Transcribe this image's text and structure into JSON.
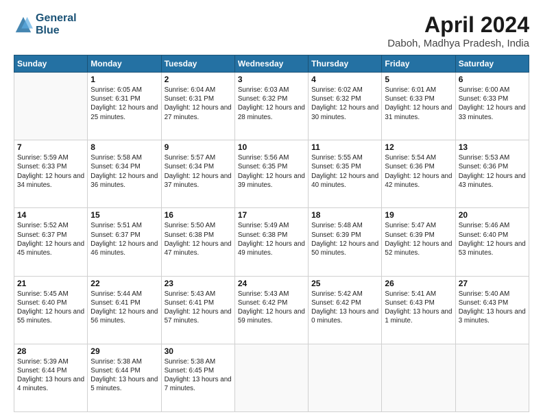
{
  "header": {
    "logo_line1": "General",
    "logo_line2": "Blue",
    "title": "April 2024",
    "subtitle": "Daboh, Madhya Pradesh, India"
  },
  "days_of_week": [
    "Sunday",
    "Monday",
    "Tuesday",
    "Wednesday",
    "Thursday",
    "Friday",
    "Saturday"
  ],
  "weeks": [
    [
      {
        "num": "",
        "info": ""
      },
      {
        "num": "1",
        "info": "Sunrise: 6:05 AM\nSunset: 6:31 PM\nDaylight: 12 hours\nand 25 minutes."
      },
      {
        "num": "2",
        "info": "Sunrise: 6:04 AM\nSunset: 6:31 PM\nDaylight: 12 hours\nand 27 minutes."
      },
      {
        "num": "3",
        "info": "Sunrise: 6:03 AM\nSunset: 6:32 PM\nDaylight: 12 hours\nand 28 minutes."
      },
      {
        "num": "4",
        "info": "Sunrise: 6:02 AM\nSunset: 6:32 PM\nDaylight: 12 hours\nand 30 minutes."
      },
      {
        "num": "5",
        "info": "Sunrise: 6:01 AM\nSunset: 6:33 PM\nDaylight: 12 hours\nand 31 minutes."
      },
      {
        "num": "6",
        "info": "Sunrise: 6:00 AM\nSunset: 6:33 PM\nDaylight: 12 hours\nand 33 minutes."
      }
    ],
    [
      {
        "num": "7",
        "info": "Sunrise: 5:59 AM\nSunset: 6:33 PM\nDaylight: 12 hours\nand 34 minutes."
      },
      {
        "num": "8",
        "info": "Sunrise: 5:58 AM\nSunset: 6:34 PM\nDaylight: 12 hours\nand 36 minutes."
      },
      {
        "num": "9",
        "info": "Sunrise: 5:57 AM\nSunset: 6:34 PM\nDaylight: 12 hours\nand 37 minutes."
      },
      {
        "num": "10",
        "info": "Sunrise: 5:56 AM\nSunset: 6:35 PM\nDaylight: 12 hours\nand 39 minutes."
      },
      {
        "num": "11",
        "info": "Sunrise: 5:55 AM\nSunset: 6:35 PM\nDaylight: 12 hours\nand 40 minutes."
      },
      {
        "num": "12",
        "info": "Sunrise: 5:54 AM\nSunset: 6:36 PM\nDaylight: 12 hours\nand 42 minutes."
      },
      {
        "num": "13",
        "info": "Sunrise: 5:53 AM\nSunset: 6:36 PM\nDaylight: 12 hours\nand 43 minutes."
      }
    ],
    [
      {
        "num": "14",
        "info": "Sunrise: 5:52 AM\nSunset: 6:37 PM\nDaylight: 12 hours\nand 45 minutes."
      },
      {
        "num": "15",
        "info": "Sunrise: 5:51 AM\nSunset: 6:37 PM\nDaylight: 12 hours\nand 46 minutes."
      },
      {
        "num": "16",
        "info": "Sunrise: 5:50 AM\nSunset: 6:38 PM\nDaylight: 12 hours\nand 47 minutes."
      },
      {
        "num": "17",
        "info": "Sunrise: 5:49 AM\nSunset: 6:38 PM\nDaylight: 12 hours\nand 49 minutes."
      },
      {
        "num": "18",
        "info": "Sunrise: 5:48 AM\nSunset: 6:39 PM\nDaylight: 12 hours\nand 50 minutes."
      },
      {
        "num": "19",
        "info": "Sunrise: 5:47 AM\nSunset: 6:39 PM\nDaylight: 12 hours\nand 52 minutes."
      },
      {
        "num": "20",
        "info": "Sunrise: 5:46 AM\nSunset: 6:40 PM\nDaylight: 12 hours\nand 53 minutes."
      }
    ],
    [
      {
        "num": "21",
        "info": "Sunrise: 5:45 AM\nSunset: 6:40 PM\nDaylight: 12 hours\nand 55 minutes."
      },
      {
        "num": "22",
        "info": "Sunrise: 5:44 AM\nSunset: 6:41 PM\nDaylight: 12 hours\nand 56 minutes."
      },
      {
        "num": "23",
        "info": "Sunrise: 5:43 AM\nSunset: 6:41 PM\nDaylight: 12 hours\nand 57 minutes."
      },
      {
        "num": "24",
        "info": "Sunrise: 5:43 AM\nSunset: 6:42 PM\nDaylight: 12 hours\nand 59 minutes."
      },
      {
        "num": "25",
        "info": "Sunrise: 5:42 AM\nSunset: 6:42 PM\nDaylight: 13 hours\nand 0 minutes."
      },
      {
        "num": "26",
        "info": "Sunrise: 5:41 AM\nSunset: 6:43 PM\nDaylight: 13 hours\nand 1 minute."
      },
      {
        "num": "27",
        "info": "Sunrise: 5:40 AM\nSunset: 6:43 PM\nDaylight: 13 hours\nand 3 minutes."
      }
    ],
    [
      {
        "num": "28",
        "info": "Sunrise: 5:39 AM\nSunset: 6:44 PM\nDaylight: 13 hours\nand 4 minutes."
      },
      {
        "num": "29",
        "info": "Sunrise: 5:38 AM\nSunset: 6:44 PM\nDaylight: 13 hours\nand 5 minutes."
      },
      {
        "num": "30",
        "info": "Sunrise: 5:38 AM\nSunset: 6:45 PM\nDaylight: 13 hours\nand 7 minutes."
      },
      {
        "num": "",
        "info": ""
      },
      {
        "num": "",
        "info": ""
      },
      {
        "num": "",
        "info": ""
      },
      {
        "num": "",
        "info": ""
      }
    ]
  ]
}
